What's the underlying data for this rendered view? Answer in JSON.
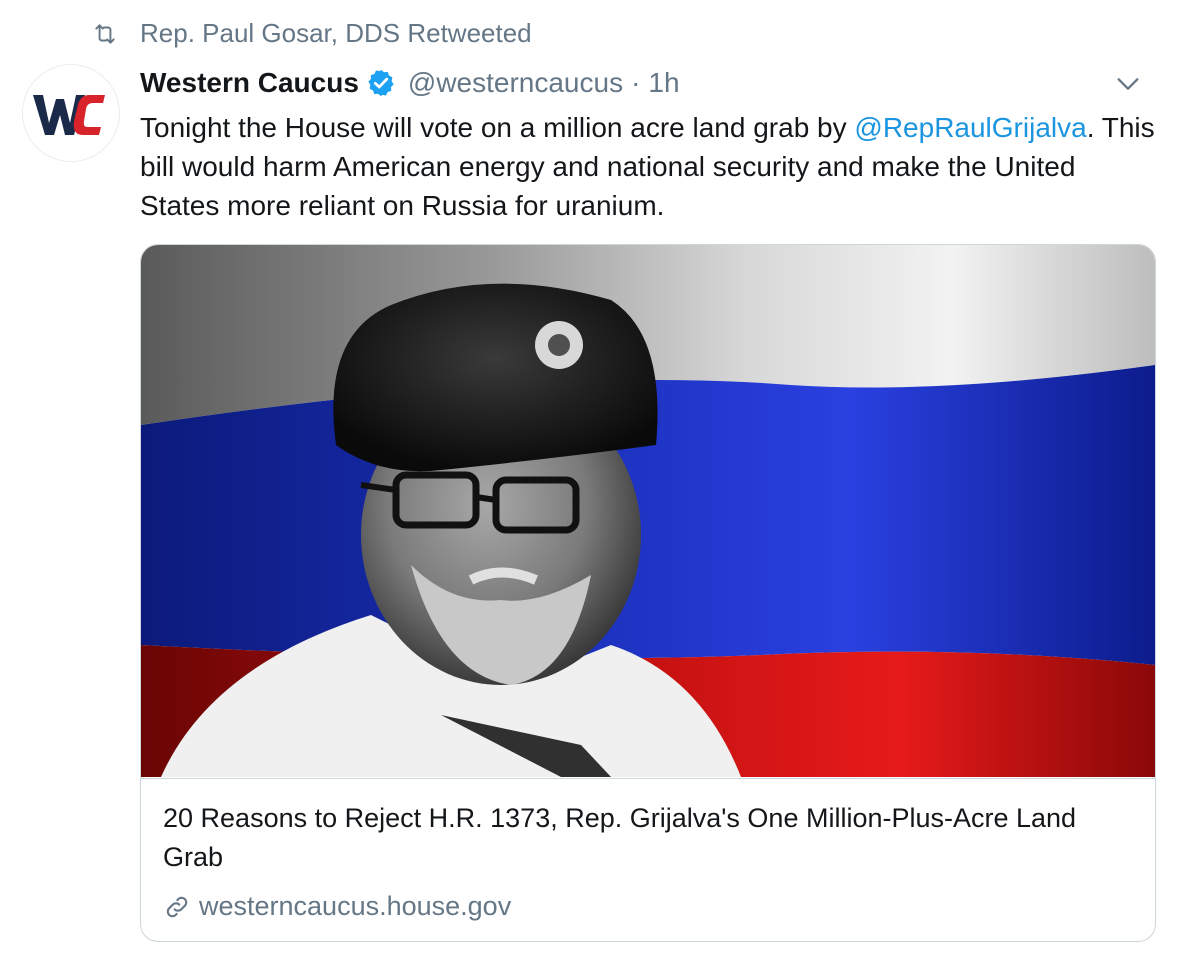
{
  "retweet": {
    "text": "Rep. Paul Gosar, DDS Retweeted",
    "icon": "retweet-icon"
  },
  "author": {
    "avatar_text": "WC",
    "display_name": "Western Caucus",
    "handle": "@westerncaucus",
    "separator": "·",
    "time": "1h"
  },
  "tweet": {
    "text_before": "Tonight the House will vote on a million acre land grab by ",
    "mention": "@RepRaulGrijalva",
    "text_after": ". This bill would harm American energy and national security and make the United States more reliant on Russia for uranium."
  },
  "card": {
    "image": "man-in-fur-hat-before-russian-flag",
    "title": "20 Reasons to Reject H.R. 1373, Rep. Grijalva's One Million-Plus-Acre Land Grab",
    "domain": "westerncaucus.house.gov",
    "link_icon": "link-icon"
  },
  "colors": {
    "link_blue": "#1b95e0",
    "secondary_gray": "#657786",
    "verified_blue": "#1da1f2",
    "logo_navy": "#1c2a4a",
    "logo_red": "#d8232a",
    "flag_white": "#e8e8e8",
    "flag_blue": "#1230c8",
    "flag_red": "#d21010"
  }
}
